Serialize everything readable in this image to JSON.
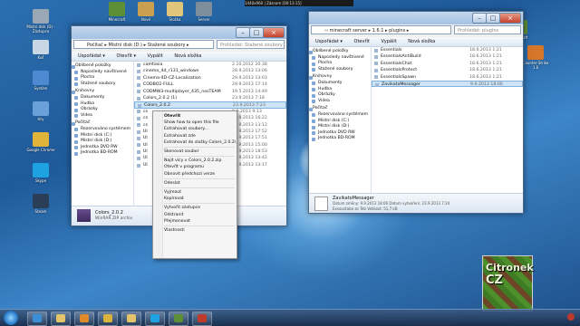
{
  "screen_banner": "1440x960 | Záznam [00:13:15]",
  "desktop_icons_left": [
    {
      "label": "Místní disk (D) - Zástupce",
      "color": "#9aa7b4"
    },
    {
      "label": "Koš",
      "color": "#c9d6e3"
    },
    {
      "label": "Systém",
      "color": "#4d8ad1"
    },
    {
      "label": "Hry",
      "color": "#6aa1d8"
    },
    {
      "label": "Google Chrome",
      "color": "#e0b43a"
    },
    {
      "label": "Skype",
      "color": "#1fa2e1"
    },
    {
      "label": "Steam",
      "color": "#2a3e57"
    }
  ],
  "desktop_icons_top": [
    {
      "label": "Minecraft",
      "color": "#5c8f36"
    },
    {
      "label": "Nové",
      "color": "#c9a04f"
    },
    {
      "label": "Složka",
      "color": "#e0c57b"
    },
    {
      "label": "Server",
      "color": "#7e8d9b"
    }
  ],
  "desktop_icons_right": [
    {
      "label": "Minecraft",
      "color": "#5e8e33"
    },
    {
      "label": "Counter-Strike 1.6",
      "color": "#d6762a"
    }
  ],
  "left_window": {
    "address": "Počítač ▸ Místní disk (D:) ▸ Stažené soubory ▸",
    "search_placeholder": "Prohledat: Stažené soubory",
    "toolbar": {
      "organize": "Uspořádat ▾",
      "open": "Otevřít ▾",
      "burn": "Vypálit",
      "new_folder": "Nová složka"
    },
    "nav": [
      {
        "label": "Oblíbené položky",
        "group": true
      },
      {
        "label": "Naposledy navštívené",
        "group": false
      },
      {
        "label": "Plocha",
        "group": false
      },
      {
        "label": "Stažené soubory",
        "group": false
      },
      {
        "label": "Knihovny",
        "group": true
      },
      {
        "label": "Dokumenty",
        "group": false
      },
      {
        "label": "Hudba",
        "group": false
      },
      {
        "label": "Obrázky",
        "group": false
      },
      {
        "label": "Videa",
        "group": false
      },
      {
        "label": "Počítač",
        "group": true
      },
      {
        "label": "Rezervováno systémem",
        "group": false
      },
      {
        "label": "Místní disk (C:)",
        "group": false
      },
      {
        "label": "Místní disk (D:)",
        "group": false
      },
      {
        "label": "Jednotka DVD RW",
        "group": false
      },
      {
        "label": "Jednotka BD-ROM",
        "group": false
      }
    ],
    "files": [
      {
        "name": "camtasia",
        "date": "2.10.2012 20:38"
      },
      {
        "name": "cinema_4d_r131_windows",
        "date": "28.9.2013 13:06"
      },
      {
        "name": "Cinema-4D-CZ-Localization",
        "date": "29.9.2013 13:03"
      },
      {
        "name": "CODBO2-FULL",
        "date": "29.9.2013 17:14"
      },
      {
        "name": "CODMW3-multiplayer_435_nosTEAM",
        "date": "19.5.2013 14:49"
      },
      {
        "name": "Colors_2.0.2 (1)",
        "date": "23.9.2013 7:18"
      },
      {
        "name": "Colors_2.0.2",
        "date": "23.9.2013 7:23"
      },
      {
        "name": "cs",
        "date": "9.9.2013 9:13"
      },
      {
        "name": "cs",
        "date": "18.9.2013 16:22"
      },
      {
        "name": "cs",
        "date": "17.9.2013 13:12"
      },
      {
        "name": "Ul",
        "date": "17.9.2013 17:52"
      },
      {
        "name": "Ul",
        "date": "17.9.2013 17:51"
      },
      {
        "name": "Ul",
        "date": "22.9.2013 15:00"
      },
      {
        "name": "Ul",
        "date": "22.9.2013 18:53"
      },
      {
        "name": "Ul",
        "date": "17.9.2013 13:42"
      },
      {
        "name": "Ul",
        "date": "17.9.2013 13:17"
      }
    ],
    "selected_index": 6,
    "details": {
      "name": "Colors_2.0.2",
      "type": "WinRAR ZIP archiv"
    }
  },
  "context_menu": [
    {
      "label": "Otevřít",
      "bold": true
    },
    {
      "label": "Show how to open this file",
      "bold": false
    },
    {
      "label": "Extrahovat soubory...",
      "bold": false
    },
    {
      "label": "Extrahovat zde",
      "bold": false
    },
    {
      "label": "Extrahovat do složky Colors_2.0.2\\",
      "bold": false
    },
    {
      "sep": true
    },
    {
      "label": "Skenovat soubor",
      "bold": false
    },
    {
      "sep": true
    },
    {
      "label": "Najít vícy v Colors_2.0.2.zip",
      "bold": false
    },
    {
      "label": "Otevřít v programu",
      "bold": false
    },
    {
      "label": "Obnovit předchozí verze",
      "bold": false
    },
    {
      "sep": true
    },
    {
      "label": "Odeslat",
      "bold": false
    },
    {
      "sep": true
    },
    {
      "label": "Vyjmout",
      "bold": false
    },
    {
      "label": "Kopírovat",
      "bold": false
    },
    {
      "sep": true
    },
    {
      "label": "Vytvořit zástupce",
      "bold": false
    },
    {
      "label": "Odstranit",
      "bold": false
    },
    {
      "label": "Přejmenovat",
      "bold": false
    },
    {
      "sep": true
    },
    {
      "label": "Vlastnosti",
      "bold": false
    }
  ],
  "right_window": {
    "address": "‹‹ minecraft server ▸ 1.6.1 ▸ plugins ▸",
    "search_placeholder": "Prohledat: plugins",
    "toolbar": {
      "organize": "Uspořádat ▾",
      "open": "Otevřít",
      "burn": "Vypálit",
      "new_folder": "Nová složka"
    },
    "nav": [
      {
        "label": "Oblíbené položky",
        "group": true
      },
      {
        "label": "Naposledy navštívené",
        "group": false
      },
      {
        "label": "Plocha",
        "group": false
      },
      {
        "label": "Stažené soubory",
        "group": false
      },
      {
        "label": "Knihovny",
        "group": true
      },
      {
        "label": "Dokumenty",
        "group": false
      },
      {
        "label": "Hudba",
        "group": false
      },
      {
        "label": "Obrázky",
        "group": false
      },
      {
        "label": "Videa",
        "group": false
      },
      {
        "label": "Počítač",
        "group": true
      },
      {
        "label": "Rezervováno systémem",
        "group": false
      },
      {
        "label": "Místní disk (C:)",
        "group": false
      },
      {
        "label": "Místní disk (D:)",
        "group": false
      },
      {
        "label": "Jednotka DVD RW",
        "group": false
      },
      {
        "label": "Jednotka BD-ROM",
        "group": false
      }
    ],
    "files": [
      {
        "name": "Essentials",
        "date": "18.6.2013 1:21"
      },
      {
        "name": "EssentialsAntiBuild",
        "date": "18.6.2013 1:21"
      },
      {
        "name": "EssentialsChat",
        "date": "18.6.2013 1:21"
      },
      {
        "name": "EssentialsProtect",
        "date": "18.6.2013 1:21"
      },
      {
        "name": "EssentialsSpawn",
        "date": "18.6.2013 1:21"
      },
      {
        "name": "ZavikatoMessager",
        "date": "9.9.2013 18:06"
      }
    ],
    "selected_index": 5,
    "details": {
      "name": "ZavikatoMessager",
      "line1": "Datum změny: 9.9.2013 18:06   Datum vytvoření: 23.9.2013 7:24",
      "line2": "Exsoustabe ze Teb   Velikost: 51,7 kB"
    }
  },
  "taskbar": {
    "buttons": [
      {
        "label": "Internet Explorer",
        "color": "#3b8fd6"
      },
      {
        "label": "Průzkumník",
        "color": "#e3c46a"
      },
      {
        "label": "Media Player",
        "color": "#e08a2b"
      },
      {
        "label": "Chrome",
        "color": "#d9b33e"
      },
      {
        "label": "Průzkumník",
        "color": "#e3c46a"
      },
      {
        "label": "Skype",
        "color": "#1fa2e1"
      },
      {
        "label": "Minecraft",
        "color": "#5c8f36"
      },
      {
        "label": "Záznam",
        "color": "#c03a2b"
      }
    ]
  },
  "brand": {
    "line1": "Citronek",
    "line2": "CZ"
  }
}
